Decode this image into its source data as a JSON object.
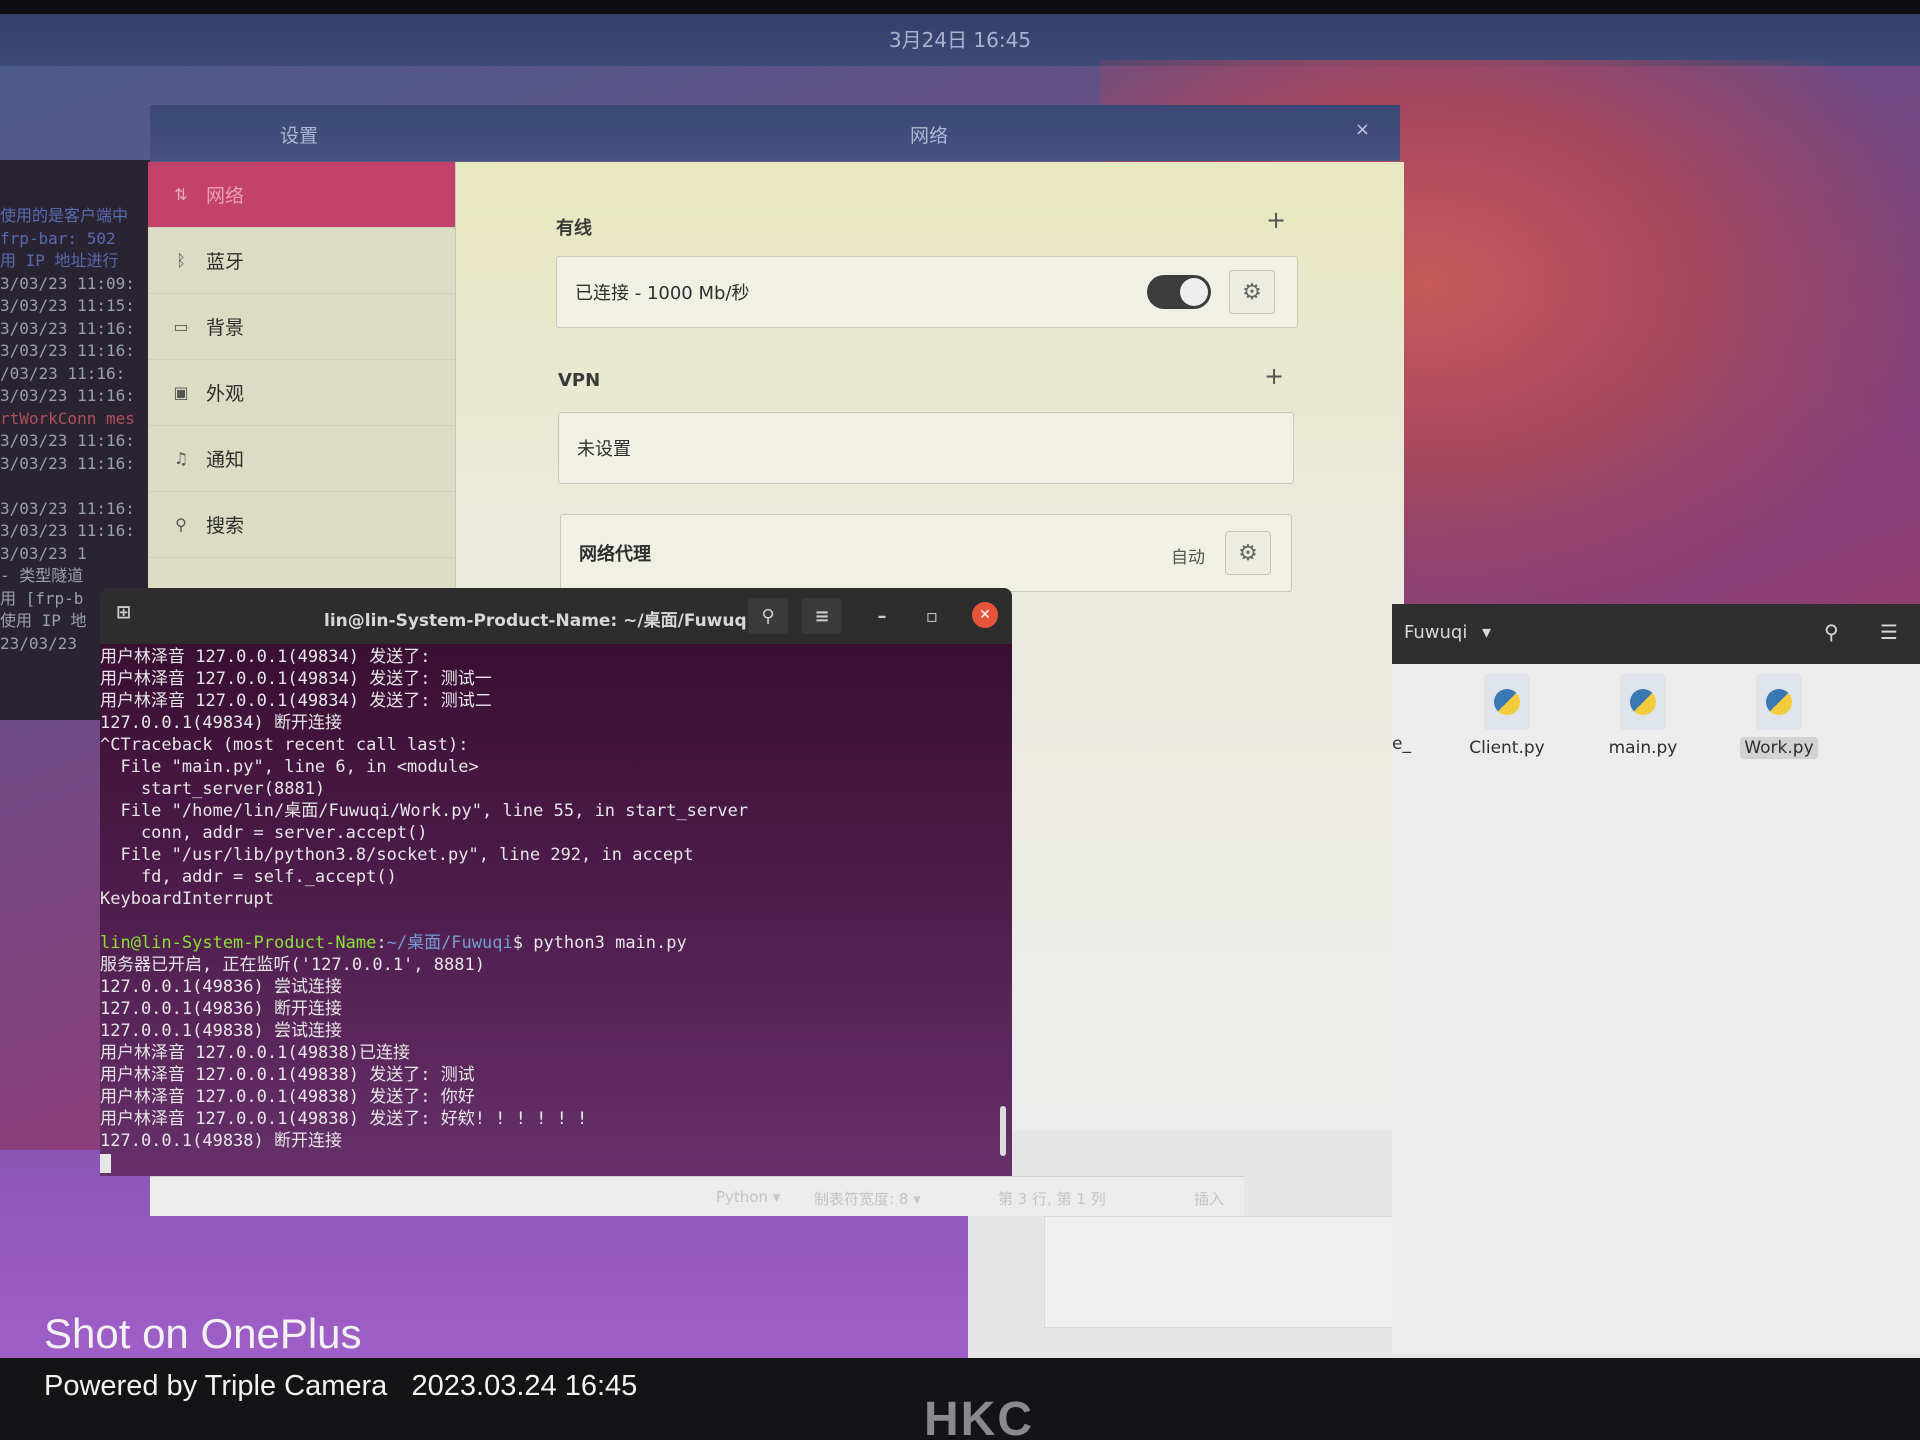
{
  "topbar": {
    "clock": "3月24日 16:45"
  },
  "settings": {
    "title_left": "设置",
    "title_center": "网络",
    "close_glyph": "×",
    "sidebar": [
      {
        "label": "网络",
        "icon": "network-icon",
        "glyph": "⇅",
        "active": true
      },
      {
        "label": "蓝牙",
        "icon": "bluetooth-icon",
        "glyph": "ᛒ",
        "active": false
      },
      {
        "label": "背景",
        "icon": "background-icon",
        "glyph": "▭",
        "active": false
      },
      {
        "label": "外观",
        "icon": "appearance-icon",
        "glyph": "▣",
        "active": false
      },
      {
        "label": "通知",
        "icon": "bell-icon",
        "glyph": "♫",
        "active": false
      },
      {
        "label": "搜索",
        "icon": "search-icon",
        "glyph": "⚲",
        "active": false
      }
    ],
    "wired": {
      "label": "有线",
      "add": "+",
      "status": "已连接 - 1000 Mb/秒",
      "toggle_on": true
    },
    "vpn": {
      "label": "VPN",
      "add": "+",
      "status": "未设置"
    },
    "proxy": {
      "label": "网络代理",
      "mode": "自动"
    },
    "gear_glyph": "⚙"
  },
  "bg_terminal": {
    "lines": [
      {
        "text": "",
        "cls": ""
      },
      {
        "text": "",
        "cls": ""
      },
      {
        "text": "使用的是客户端中",
        "cls": "blue"
      },
      {
        "text": "  frp-bar: 502",
        "cls": "blue"
      },
      {
        "text": "用 IP 地址进行",
        "cls": "blue"
      },
      {
        "text": "3/03/23 11:09:",
        "cls": ""
      },
      {
        "text": "3/03/23 11:15:",
        "cls": ""
      },
      {
        "text": "3/03/23 11:16:",
        "cls": ""
      },
      {
        "text": "3/03/23 11:16:",
        "cls": ""
      },
      {
        "text": "/03/23 11:16:",
        "cls": ""
      },
      {
        "text": "3/03/23 11:16:",
        "cls": ""
      },
      {
        "text": "rtWorkConn mes",
        "cls": "red"
      },
      {
        "text": "3/03/23 11:16:",
        "cls": ""
      },
      {
        "text": "3/03/23 11:16:",
        "cls": ""
      },
      {
        "text": "",
        "cls": ""
      },
      {
        "text": "3/03/23 11:16:",
        "cls": ""
      },
      {
        "text": "3/03/23 11:16:",
        "cls": ""
      },
      {
        "text": "3/03/23 1",
        "cls": ""
      },
      {
        "text": "- 类型隧道",
        "cls": ""
      },
      {
        "text": "用 [frp-b",
        "cls": ""
      },
      {
        "text": "使用 IP 地",
        "cls": ""
      },
      {
        "text": "23/03/23",
        "cls": ""
      }
    ]
  },
  "terminal": {
    "title": "lin@lin-System-Product-Name: ~/桌面/Fuwuqi",
    "search_glyph": "⚲",
    "menu_glyph": "≡",
    "min_glyph": "–",
    "max_glyph": "▫",
    "close_glyph": "✕",
    "lines_top": [
      "用户林泽音 127.0.0.1(49834) 发送了:",
      "用户林泽音 127.0.0.1(49834) 发送了: 测试一",
      "用户林泽音 127.0.0.1(49834) 发送了: 测试二",
      "127.0.0.1(49834) 断开连接",
      "^CTraceback (most recent call last):",
      "  File \"main.py\", line 6, in <module>",
      "    start_server(8881)",
      "  File \"/home/lin/桌面/Fuwuqi/Work.py\", line 55, in start_server",
      "    conn, addr = server.accept()",
      "  File \"/usr/lib/python3.8/socket.py\", line 292, in accept",
      "    fd, addr = self._accept()",
      "KeyboardInterrupt",
      ""
    ],
    "prompt_user": "lin@lin-System-Product-Name",
    "prompt_sep": ":",
    "prompt_path": "~/桌面/Fuwuqi",
    "prompt_end": "$ ",
    "command": "python3 main.py",
    "lines_bottom": [
      "服务器已开启, 正在监听('127.0.0.1', 8881)",
      "127.0.0.1(49836) 尝试连接",
      "127.0.0.1(49836) 断开连接",
      "127.0.0.1(49838) 尝试连接",
      "用户林泽音 127.0.0.1(49838)已连接",
      "用户林泽音 127.0.0.1(49838) 发送了: 测试",
      "用户林泽音 127.0.0.1(49838) 发送了: 你好",
      "用户林泽音 127.0.0.1(49838) 发送了: 好欸! ! ! ! ! !",
      "127.0.0.1(49838) 断开连接"
    ]
  },
  "editor_status": {
    "language": "Python ▾",
    "tab_width": "制表符宽度: 8 ▾",
    "position": "第 3 行, 第 1 列",
    "mode": "插入"
  },
  "file_manager": {
    "folder": "Fuwuqi",
    "dropdown_glyph": "▾",
    "search_glyph": "⚲",
    "menu_glyph": "☰",
    "partial_name": "e_",
    "files": [
      {
        "name": "Client.py",
        "selected": false
      },
      {
        "name": "main.py",
        "selected": false
      },
      {
        "name": "Work.py",
        "selected": true
      }
    ]
  },
  "watermark": {
    "line1": "Shot on OnePlus",
    "line2": "Powered by Triple Camera",
    "datetime": "2023.03.24 16:45"
  },
  "monitor_brand": "HKC"
}
